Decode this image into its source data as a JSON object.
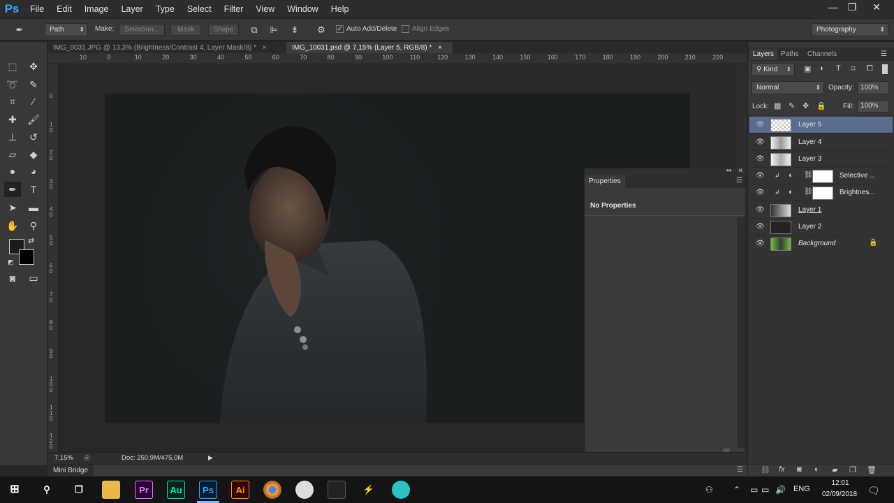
{
  "menu": {
    "logo": "Ps",
    "items": [
      "File",
      "Edit",
      "Image",
      "Layer",
      "Type",
      "Select",
      "Filter",
      "View",
      "Window",
      "Help"
    ]
  },
  "window_controls": {
    "minimize": "—",
    "restore": "❐",
    "close": "✕"
  },
  "options_bar": {
    "tool_mode": "Path",
    "make_label": "Make:",
    "selection_btn": "Selection...",
    "mask_btn": "Mask",
    "shape_btn": "Shape",
    "auto_add_delete": "Auto Add/Delete",
    "auto_add_checked": "✓",
    "align_edges": "Align Edges",
    "workspace": "Photography"
  },
  "doc_tabs": [
    {
      "title": "IMG_0031.JPG @ 13,3% (Brightness/Contrast 4, Layer Mask/8) *",
      "close": "×"
    },
    {
      "title": "IMG_10031.psd @ 7,15% (Layer 5, RGB/8) *",
      "close": "×"
    }
  ],
  "ruler_top": [
    "10",
    "0",
    "10",
    "20",
    "30",
    "40",
    "50",
    "60",
    "70",
    "80",
    "90",
    "100",
    "110",
    "120",
    "130",
    "140",
    "150",
    "160",
    "170",
    "180",
    "190",
    "200",
    "210",
    "220"
  ],
  "ruler_left": [
    "0",
    "1 0",
    "2 0",
    "3 0",
    "4 0",
    "5 0",
    "6 0",
    "7 0",
    "8 0",
    "9 0",
    "1 0 0",
    "1 1 0",
    "1 2 0"
  ],
  "status": {
    "zoom": "7,15%",
    "doc": "Doc: 250,9M/475,0M",
    "arrow": "▶"
  },
  "mini_bridge": "Mini Bridge",
  "properties": {
    "title": "Properties",
    "content": "No Properties"
  },
  "layers_panel": {
    "tabs": [
      "Layers",
      "Paths",
      "Channels"
    ],
    "filter_kind": "Kind",
    "blend_mode": "Normal",
    "opacity_label": "Opacity:",
    "opacity_value": "100%",
    "lock_label": "Lock:",
    "fill_label": "Fill:",
    "fill_value": "100%",
    "layers": [
      {
        "name": "Layer 5"
      },
      {
        "name": "Layer 4"
      },
      {
        "name": "Layer 3"
      },
      {
        "name": "Selective ..."
      },
      {
        "name": "Brightnes..."
      },
      {
        "name": "Layer 1"
      },
      {
        "name": "Layer 2"
      },
      {
        "name": "Background"
      }
    ]
  },
  "taskbar": {
    "apps": [
      "Pr",
      "Au",
      "Ps",
      "Ai"
    ],
    "lang": "ENG",
    "time": "12:01",
    "date": "02/09/2018"
  },
  "colors": {
    "accent": "#31a8ff",
    "selected_layer": "#5b6d8f"
  }
}
